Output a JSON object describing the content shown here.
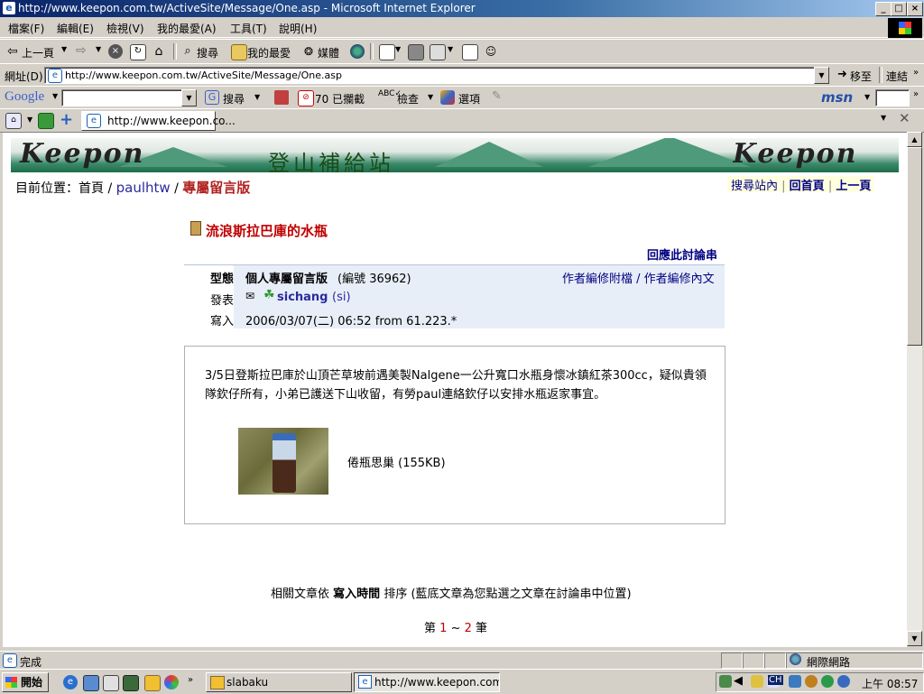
{
  "window": {
    "title": "http://www.keepon.com.tw/ActiveSite/Message/One.asp - Microsoft Internet Explorer"
  },
  "menu": [
    "檔案(F)",
    "編輯(E)",
    "檢視(V)",
    "我的最愛(A)",
    "工具(T)",
    "說明(H)"
  ],
  "toolbar": {
    "back_label": "上一頁",
    "search_label": "搜尋",
    "favorites_label": "我的最愛",
    "media_label": "媒體"
  },
  "address": {
    "label": "網址(D)",
    "url": "http://www.keepon.com.tw/ActiveSite/Message/One.asp",
    "go_label": "移至",
    "links_label": "連結"
  },
  "google_bar": {
    "logo": "Google",
    "search_label": "搜尋",
    "blocked_label": "70 已攔截",
    "check_label": "檢查",
    "options_label": "選項",
    "msn_label": "msn"
  },
  "tabs": {
    "active_tab_label": "http://www.keepon.co..."
  },
  "banner": {
    "logo_text": "Keepon",
    "site_name": "登山補給站"
  },
  "breadcrumb": {
    "prefix": "目前位置：首頁",
    "sep1": " / ",
    "user": "paulhtw",
    "sep2": " / ",
    "current": "專屬留言版"
  },
  "top_links": {
    "search_site": "搜尋站內",
    "home": "回首頁",
    "prev": "上一頁"
  },
  "message": {
    "title": "流浪斯拉巴庫的水瓶",
    "reply_thread": "回應此討論串",
    "type_label": "型態",
    "type_value": "個人專屬留言版",
    "type_id": "(編號 36962)",
    "edit_attach": "作者編修附檔",
    "edit_sep": " / ",
    "edit_content": "作者編修內文",
    "posted_label": "發表",
    "author": "sichang",
    "author_alias": "(si)",
    "written_label": "寫入",
    "written_value": "2006/03/07(二) 06:52 from 61.223.*",
    "body": "3/5日登斯拉巴庫於山頂芒草坡前遇美製Nalgene一公升寬口水瓶身懷冰鎮紅茶300cc，疑似貴領隊欽仔所有，小弟已護送下山收留，有勞paul連絡欽仔以安排水瓶返家事宜。",
    "attachment_caption": "倦瓶思巢 (155KB)"
  },
  "related": {
    "prefix": "相關文章依",
    "sort_key": "寫入時間",
    "suffix": "排序 (藍底文章為您點選之文章在討論串中位置)"
  },
  "pager": {
    "prefix": "第",
    "page1": "1",
    "tilde": " ~ ",
    "page2": "2",
    "suffix": "筆"
  },
  "status": {
    "text": "完成",
    "zone": "網際網路"
  },
  "taskbar": {
    "start_label": "開始",
    "task1": "slabaku",
    "task2": "http://www.keepon.com.tw...",
    "clock": "上午 08:57",
    "ime": "CH"
  }
}
